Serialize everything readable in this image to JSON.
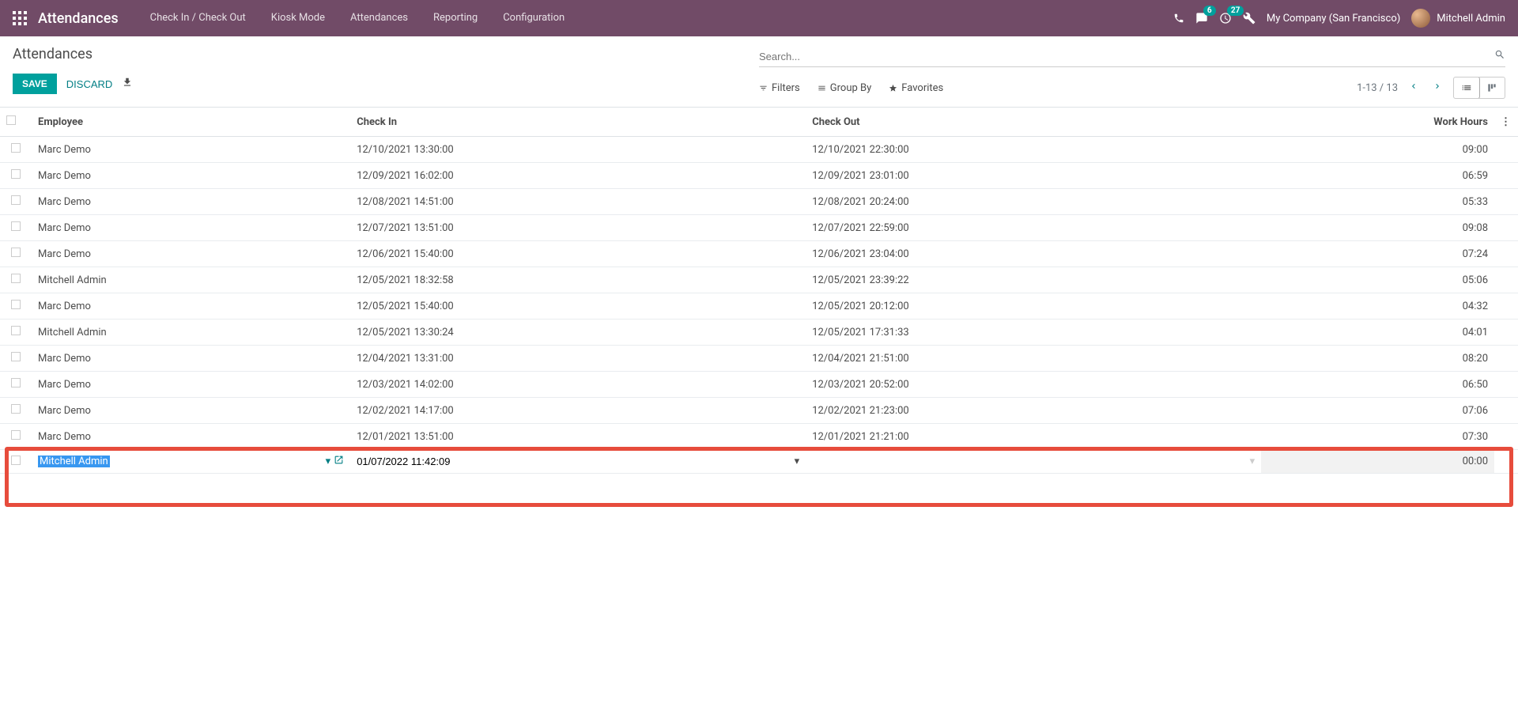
{
  "navbar": {
    "brand": "Attendances",
    "menu": [
      "Check In / Check Out",
      "Kiosk Mode",
      "Attendances",
      "Reporting",
      "Configuration"
    ],
    "badge_messages": "6",
    "badge_activities": "27",
    "company": "My Company (San Francisco)",
    "user": "Mitchell Admin"
  },
  "control": {
    "breadcrumb": "Attendances",
    "save": "SAVE",
    "discard": "DISCARD",
    "search_placeholder": "Search...",
    "filters": "Filters",
    "groupby": "Group By",
    "favorites": "Favorites",
    "pager": "1-13 / 13"
  },
  "table": {
    "headers": {
      "employee": "Employee",
      "checkin": "Check In",
      "checkout": "Check Out",
      "work_hours": "Work Hours"
    },
    "rows": [
      {
        "employee": "Marc Demo",
        "checkin": "12/10/2021 13:30:00",
        "checkout": "12/10/2021 22:30:00",
        "wh": "09:00"
      },
      {
        "employee": "Marc Demo",
        "checkin": "12/09/2021 16:02:00",
        "checkout": "12/09/2021 23:01:00",
        "wh": "06:59"
      },
      {
        "employee": "Marc Demo",
        "checkin": "12/08/2021 14:51:00",
        "checkout": "12/08/2021 20:24:00",
        "wh": "05:33"
      },
      {
        "employee": "Marc Demo",
        "checkin": "12/07/2021 13:51:00",
        "checkout": "12/07/2021 22:59:00",
        "wh": "09:08"
      },
      {
        "employee": "Marc Demo",
        "checkin": "12/06/2021 15:40:00",
        "checkout": "12/06/2021 23:04:00",
        "wh": "07:24"
      },
      {
        "employee": "Mitchell Admin",
        "checkin": "12/05/2021 18:32:58",
        "checkout": "12/05/2021 23:39:22",
        "wh": "05:06"
      },
      {
        "employee": "Marc Demo",
        "checkin": "12/05/2021 15:40:00",
        "checkout": "12/05/2021 20:12:00",
        "wh": "04:32"
      },
      {
        "employee": "Mitchell Admin",
        "checkin": "12/05/2021 13:30:24",
        "checkout": "12/05/2021 17:31:33",
        "wh": "04:01"
      },
      {
        "employee": "Marc Demo",
        "checkin": "12/04/2021 13:31:00",
        "checkout": "12/04/2021 21:51:00",
        "wh": "08:20"
      },
      {
        "employee": "Marc Demo",
        "checkin": "12/03/2021 14:02:00",
        "checkout": "12/03/2021 20:52:00",
        "wh": "06:50"
      },
      {
        "employee": "Marc Demo",
        "checkin": "12/02/2021 14:17:00",
        "checkout": "12/02/2021 21:23:00",
        "wh": "07:06"
      },
      {
        "employee": "Marc Demo",
        "checkin": "12/01/2021 13:51:00",
        "checkout": "12/01/2021 21:21:00",
        "wh": "07:30"
      }
    ],
    "edit_row": {
      "employee": "Mitchell Admin",
      "checkin": "01/07/2022 11:42:09",
      "checkout": "",
      "wh": "00:00"
    }
  }
}
